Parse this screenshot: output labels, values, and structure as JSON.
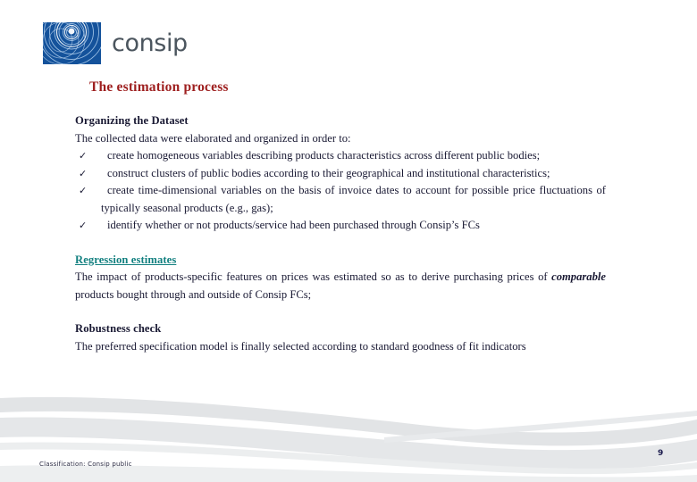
{
  "brand": {
    "logo_icon": "consip-ripple-logo-icon",
    "wordmark": "consip",
    "logo_square_color": "#14529b",
    "wordmark_color": "#4b555e"
  },
  "title": {
    "text": "The estimation process",
    "color": "#9e1f1f"
  },
  "content": {
    "section1": {
      "heading": "Organizing the Dataset",
      "intro": "The collected data were elaborated and organized in order to:",
      "bullet_glyph": "✓",
      "bullets": [
        "create homogeneous variables describing products characteristics across different public bodies;",
        "construct clusters of public bodies according to their geographical and institutional characteristics;",
        "create time-dimensional variables on the basis of invoice dates to account for possible price fluctuations of typically seasonal products (e.g., gas);",
        "identify whether or not products/service had been purchased through Consip’s FCs"
      ]
    },
    "section2": {
      "heading": "Regression estimates",
      "heading_color": "#138080",
      "body_part1": "The impact of products-specific features on prices was estimated so as to derive purchasing prices of ",
      "body_emphasis": "comparable",
      "body_part2": " products bought through and outside of Consip FCs;"
    },
    "section3": {
      "heading": "Robustness check",
      "body": "The preferred specification model is finally selected according to standard goodness of fit indicators"
    }
  },
  "footer": {
    "classification": "Classification: Consip public",
    "page_number": "9",
    "swoosh_color": "#e2e4e6"
  }
}
